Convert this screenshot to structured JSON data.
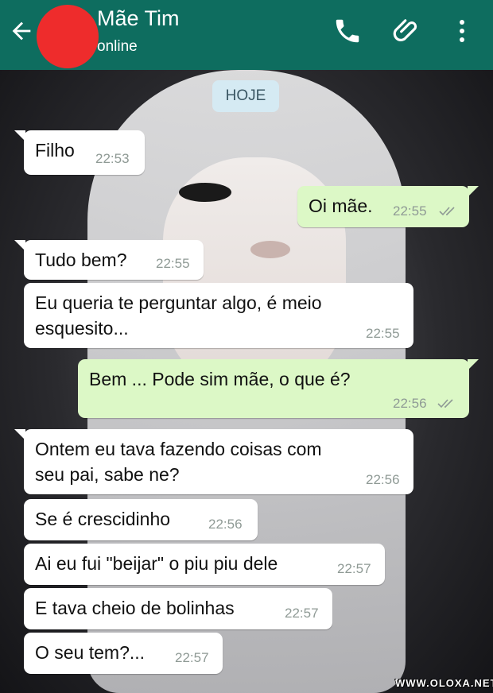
{
  "header": {
    "contact_name": "Mãe Tim",
    "status": "online",
    "colors": {
      "bar": "#0e6d5f",
      "avatar_scribble": "#ee2c2c"
    },
    "icons": [
      "back-arrow-icon",
      "phone-icon",
      "paperclip-icon",
      "more-vert-icon"
    ]
  },
  "date_chip": "HOJE",
  "messages": [
    {
      "side": "in",
      "text": "Filho",
      "time": "22:53"
    },
    {
      "side": "out",
      "text": "Oi mãe.",
      "time": "22:55"
    },
    {
      "side": "in",
      "text": "Tudo bem?",
      "time": "22:55"
    },
    {
      "side": "in",
      "text": "Eu queria te perguntar algo, é meio esquesito...",
      "time": "22:55"
    },
    {
      "side": "out",
      "text": "Bem ... Pode sim mãe, o que é?",
      "time": "22:56"
    },
    {
      "side": "in",
      "text": "Ontem eu tava fazendo coisas com seu pai, sabe ne?",
      "time": "22:56"
    },
    {
      "side": "in",
      "text": "Se é crescidinho",
      "time": "22:56"
    },
    {
      "side": "in",
      "text": "Ai eu fui \"beijar\" o piu piu dele",
      "time": "22:57"
    },
    {
      "side": "in",
      "text": "E tava cheio de bolinhas",
      "time": "22:57"
    },
    {
      "side": "in",
      "text": "O seu tem?...",
      "time": "22:57"
    }
  ],
  "lines": {
    "m3_line1": "Eu queria te perguntar algo, é meio",
    "m3_line2": "esquesito...",
    "m5_line1": "Ontem eu tava fazendo coisas com",
    "m5_line2": "seu pai, sabe ne?"
  },
  "watermark": "WWW.OLOXA.NET",
  "colors": {
    "incoming": "#ffffff",
    "outgoing": "#dcf8c6",
    "tick": "#8f9a95"
  }
}
